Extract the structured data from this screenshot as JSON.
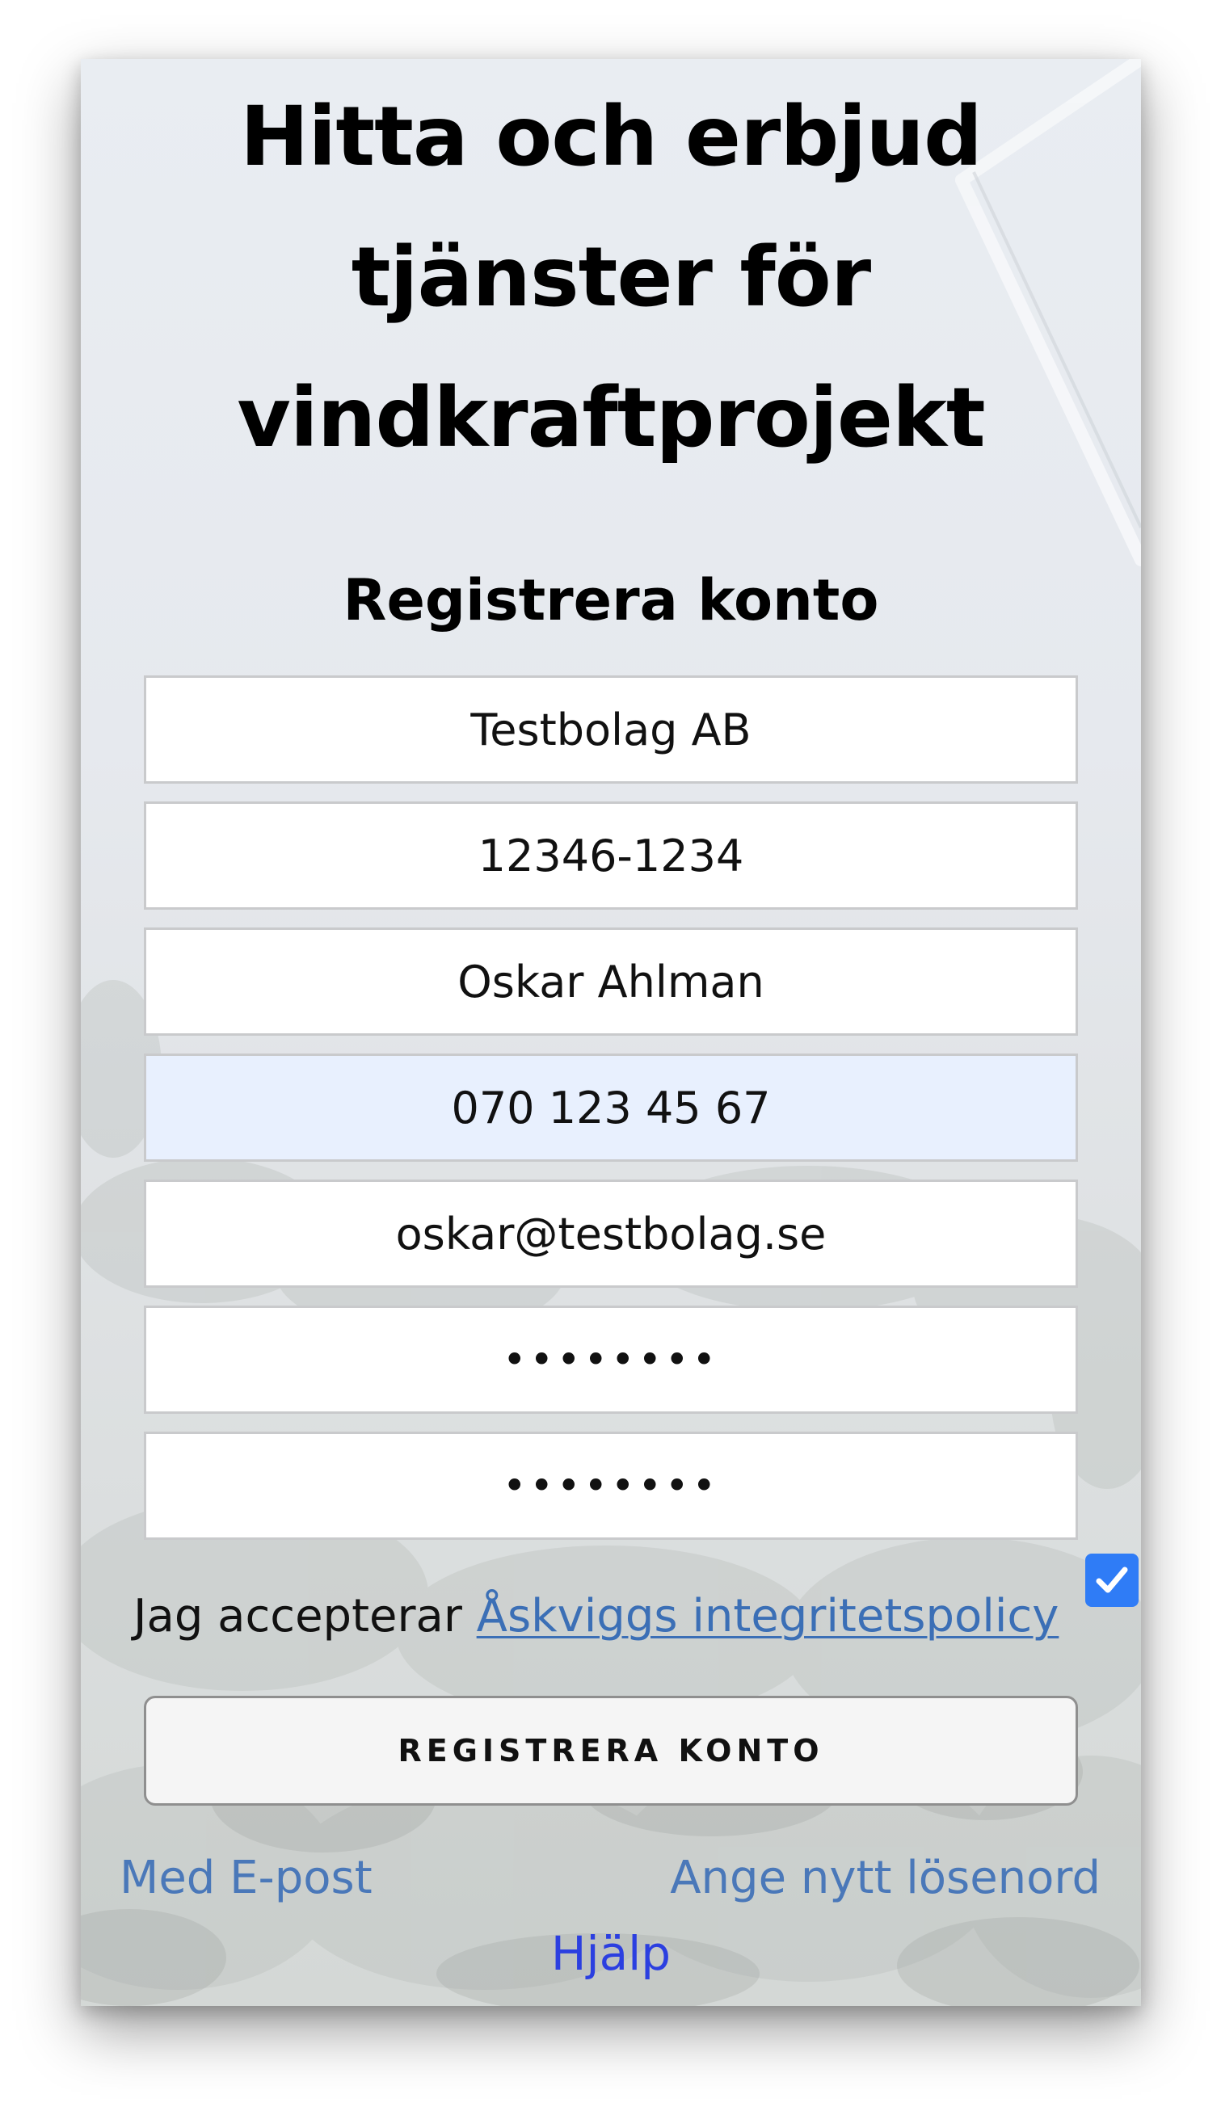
{
  "hero": {
    "title": "Hitta och erbjud tjänster för vindkraftprojekt"
  },
  "form": {
    "title": "Registrera konto",
    "fields": {
      "company": {
        "value": "Testbolag AB"
      },
      "org_number": {
        "value": "12346-1234"
      },
      "name": {
        "value": "Oskar Ahlman"
      },
      "phone": {
        "value": "070 123 45 67"
      },
      "email": {
        "value": "oskar@testbolag.se"
      },
      "password": {
        "value": "••••••••"
      },
      "password_confirm": {
        "value": "••••••••"
      }
    },
    "consent": {
      "text": "Jag accepterar ",
      "link_label": "Åskviggs integritetspolicy",
      "checked": true
    },
    "submit_label": "REGISTRERA KONTO"
  },
  "links": {
    "email_login": "Med E-post",
    "reset_password": "Ange nytt lösenord",
    "help": "Hjälp"
  },
  "colors": {
    "link": "#4a78b9",
    "help_link": "#2b3fe0",
    "checkbox": "#2f7cf6",
    "autofill_bg": "#e8f0fe"
  },
  "icons": {
    "checkbox": "check-icon"
  }
}
